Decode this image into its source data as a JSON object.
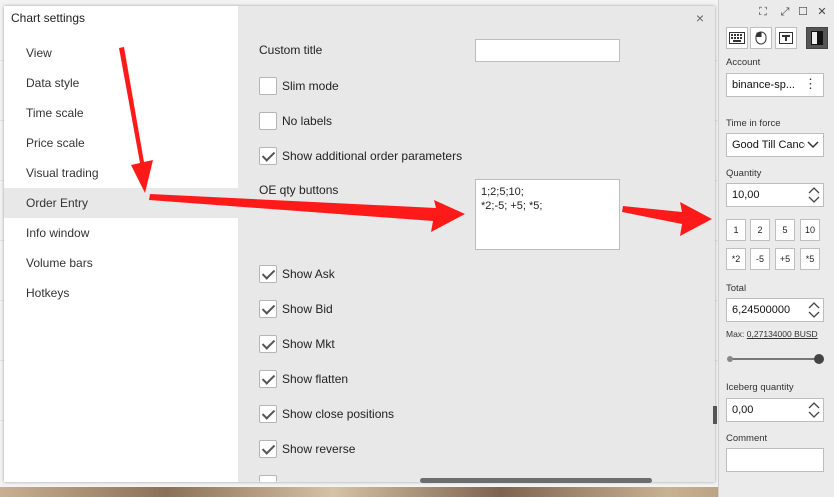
{
  "dialog": {
    "title": "Chart settings",
    "close_label": "×",
    "nav": [
      {
        "label": "View"
      },
      {
        "label": "Data style"
      },
      {
        "label": "Time scale"
      },
      {
        "label": "Price scale"
      },
      {
        "label": "Visual trading"
      },
      {
        "label": "Order Entry",
        "active": true
      },
      {
        "label": "Info window"
      },
      {
        "label": "Volume bars"
      },
      {
        "label": "Hotkeys"
      }
    ],
    "fields": {
      "custom_title": {
        "label": "Custom title",
        "value": ""
      },
      "oe_qty": {
        "label": "OE qty buttons",
        "value": "1;2;5;10;\n*2;-5; +5; *5;"
      }
    },
    "checkboxes": [
      {
        "label": "Slim mode",
        "checked": false
      },
      {
        "label": "No labels",
        "checked": false
      },
      {
        "label": "Show additional order parameters",
        "checked": true
      },
      {
        "label": "Show Ask",
        "checked": true
      },
      {
        "label": "Show Bid",
        "checked": true
      },
      {
        "label": "Show Mkt",
        "checked": true
      },
      {
        "label": "Show flatten",
        "checked": true
      },
      {
        "label": "Show close positions",
        "checked": true
      },
      {
        "label": "Show reverse",
        "checked": true
      }
    ]
  },
  "panel": {
    "window_icons": [
      "collapse-icon",
      "fullscreen-icon",
      "maximize-icon",
      "close-icon"
    ],
    "window_glyphs": [
      "⛶",
      "⤢",
      "☐",
      "✕"
    ],
    "account": {
      "label": "Account",
      "value": "binance-sp...",
      "menu": "⋮"
    },
    "time_in_force": {
      "label": "Time in force",
      "value": "Good Till Cance"
    },
    "quantity": {
      "label": "Quantity",
      "value": "10,00"
    },
    "qty_buttons_row1": [
      "1",
      "2",
      "5",
      "10"
    ],
    "qty_buttons_row2": [
      "*2",
      "-5",
      "+5",
      "*5"
    ],
    "total": {
      "label": "Total",
      "value": "6,24500000"
    },
    "max": {
      "prefix": "Max:",
      "value": "0,27134000 BUSD"
    },
    "slider_fraction": 1.0,
    "iceberg": {
      "label": "Iceberg quantity",
      "value": "0,00"
    },
    "comment": {
      "label": "Comment",
      "value": ""
    }
  },
  "colors": {
    "arrow": "#ff1a1a",
    "accent": "#444444"
  }
}
